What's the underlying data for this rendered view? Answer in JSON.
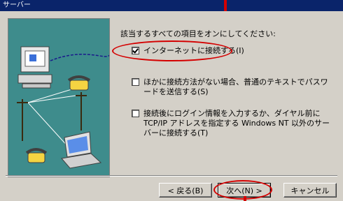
{
  "window": {
    "title": "サーバー"
  },
  "instruction": "該当するすべての項目をオンにしてください:",
  "options": [
    {
      "label": "インターネットに接続する(I)",
      "checked": true
    },
    {
      "label": "ほかに接続方法がない場合、普通のテキストでパスワードを送信する(S)",
      "checked": false
    },
    {
      "label": "接続後にログイン情報を入力するか、ダイヤル前に TCP/IP アドレスを指定する Windows NT 以外のサーバーに接続する(T)",
      "checked": false
    }
  ],
  "buttons": {
    "back": "< 戻る(B)",
    "next": "次へ(N) >",
    "cancel": "キャンセル"
  },
  "colors": {
    "highlight_red": "#d40000",
    "panel_teal": "#3e8c8c",
    "titlebar": "#0a246a"
  },
  "illustration_icons": [
    "computer-icon",
    "telephone-icon",
    "utility-pole-icon",
    "laptop-icon"
  ]
}
